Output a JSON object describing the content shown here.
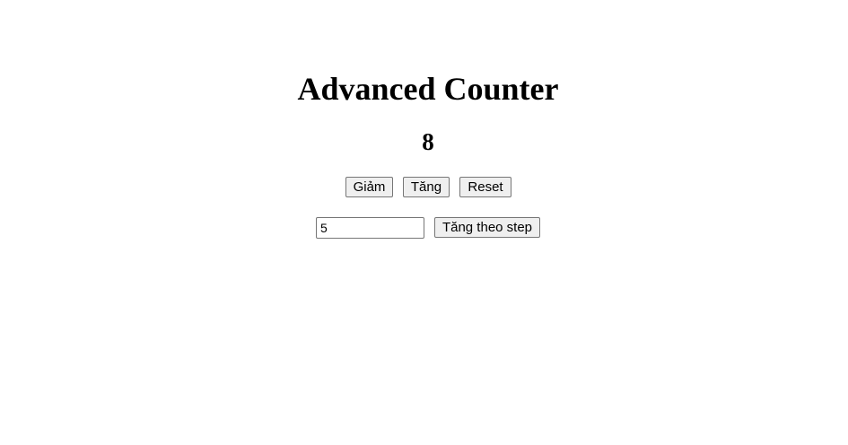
{
  "counter": {
    "title": "Advanced Counter",
    "value": "8"
  },
  "controls": {
    "decrease_label": "Giảm",
    "increase_label": "Tăng",
    "reset_label": "Reset"
  },
  "step": {
    "value": "5",
    "button_label": "Tăng theo step"
  }
}
